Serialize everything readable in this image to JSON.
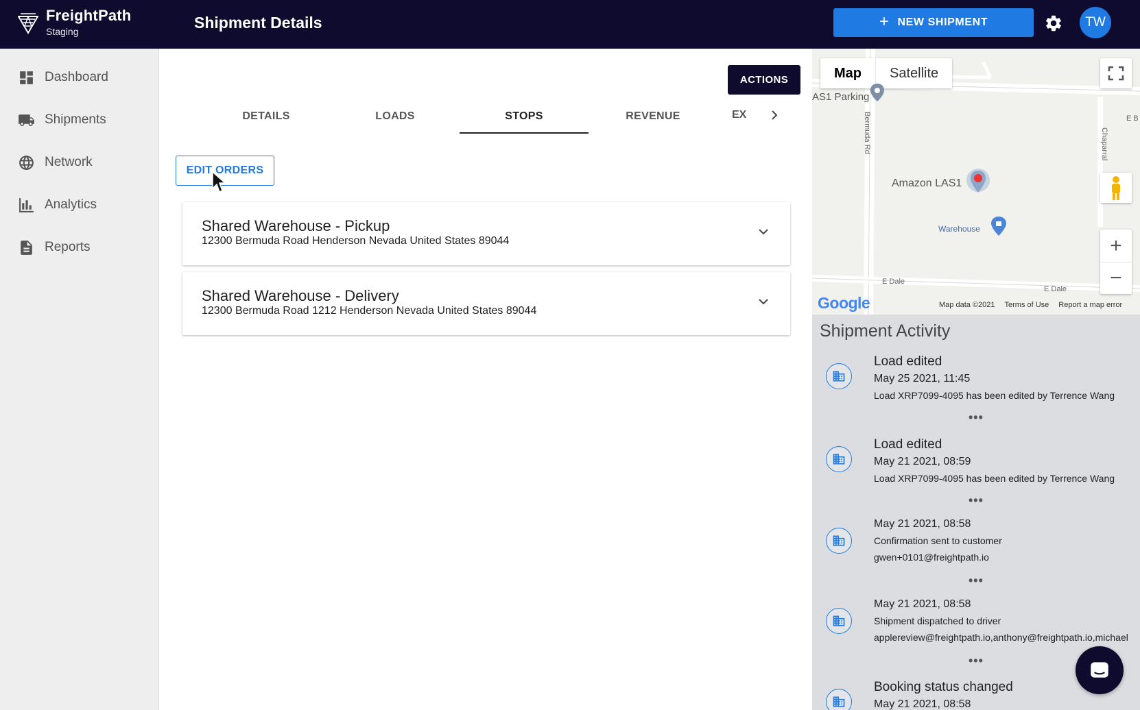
{
  "app": {
    "name": "FreightPath",
    "env": "Staging",
    "page_title": "Shipment Details"
  },
  "header": {
    "new_shipment_label": "NEW SHIPMENT",
    "user_initials": "TW",
    "accent": "#1f7be3",
    "bar_color": "#0f0b2e"
  },
  "sidebar": {
    "items": [
      {
        "label": "Dashboard",
        "icon": "dashboard-icon"
      },
      {
        "label": "Shipments",
        "icon": "truck-icon"
      },
      {
        "label": "Network",
        "icon": "globe-icon"
      },
      {
        "label": "Analytics",
        "icon": "bar-chart-icon"
      },
      {
        "label": "Reports",
        "icon": "document-icon"
      }
    ]
  },
  "main": {
    "actions_label": "ACTIONS",
    "tabs": [
      {
        "label": "DETAILS"
      },
      {
        "label": "LOADS"
      },
      {
        "label": "STOPS",
        "active": true
      },
      {
        "label": "REVENUE"
      }
    ],
    "tab_overflow": "EX",
    "edit_orders_label": "EDIT ORDERS",
    "stops": [
      {
        "title": "Shared Warehouse - Pickup",
        "address": "12300 Bermuda Road Henderson Nevada United States 89044"
      },
      {
        "title": "Shared Warehouse - Delivery",
        "address": "12300 Bermuda Road 1212 Henderson Nevada United States 89044"
      }
    ]
  },
  "map": {
    "type_map": "Map",
    "type_satellite": "Satellite",
    "labels": {
      "parking": "AS1 Parking",
      "amazon": "Amazon LAS1",
      "warehouse": "Warehouse",
      "bermuda": "Bermuda Rd",
      "chaparral": "Chaparral",
      "dale1": "E Dale",
      "dale2": "E Dale",
      "eb": "E B"
    },
    "google": "Google",
    "footer": {
      "data": "Map data ©2021",
      "terms": "Terms of Use",
      "report": "Report a map error"
    },
    "zoom_in": "+",
    "zoom_out": "−"
  },
  "activity": {
    "title": "Shipment Activity",
    "entries": [
      {
        "heading": "Load edited",
        "date": "May 25 2021, 11:45",
        "lines": [
          "Load XRP7099-4095 has been edited by Terrence Wang"
        ]
      },
      {
        "heading": "Load edited",
        "date": "May 21 2021, 08:59",
        "lines": [
          "Load XRP7099-4095 has been edited by Terrence Wang"
        ]
      },
      {
        "heading": "",
        "date": "May 21 2021, 08:58",
        "lines": [
          "Confirmation sent to customer",
          "gwen+0101@freightpath.io"
        ]
      },
      {
        "heading": "",
        "date": "May 21 2021, 08:58",
        "lines": [
          "Shipment dispatched to driver",
          "applereview@freightpath.io,anthony@freightpath.io,michael"
        ]
      },
      {
        "heading": "Booking status changed",
        "date": "May 21 2021, 08:58",
        "lines": []
      }
    ],
    "dots": "•••"
  }
}
